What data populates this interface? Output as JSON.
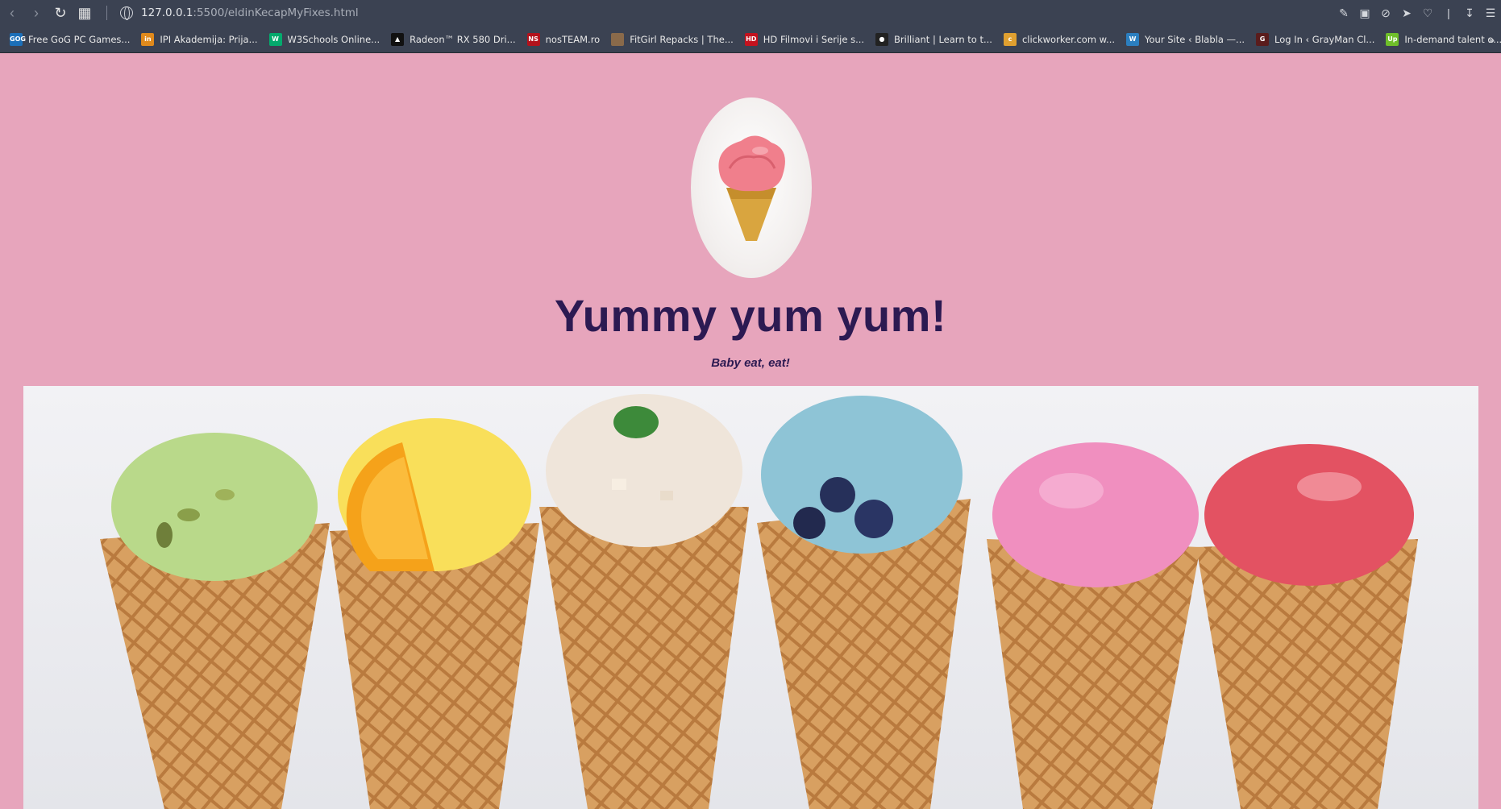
{
  "browser": {
    "url_host": "127.0.0.1",
    "url_path": ":5500/eldinKecapMyFixes.html",
    "bookmarks": [
      {
        "label": "Free GoG PC Games...",
        "color": "#1c6fb8",
        "icon_text": "GOG"
      },
      {
        "label": "IPI Akademija: Prija...",
        "color": "#e08a1c",
        "icon_text": "in"
      },
      {
        "label": "W3Schools Online...",
        "color": "#04aa6d",
        "icon_text": "W"
      },
      {
        "label": "Radeon™ RX 580 Dri...",
        "color": "#111111",
        "icon_text": "▲"
      },
      {
        "label": "nosTEAM.ro",
        "color": "#b3121c",
        "icon_text": "NS"
      },
      {
        "label": "FitGirl Repacks | The...",
        "color": "#8a6a4a",
        "icon_text": ""
      },
      {
        "label": "HD Filmovi i Serije s...",
        "color": "#c4121e",
        "icon_text": "HD"
      },
      {
        "label": "Brilliant | Learn to t...",
        "color": "#222222",
        "icon_text": "●"
      },
      {
        "label": "clickworker.com w...",
        "color": "#e0a030",
        "icon_text": "c"
      },
      {
        "label": "Your Site ‹ Blabla —...",
        "color": "#2b7fc0",
        "icon_text": "W"
      },
      {
        "label": "Log In ‹ GrayMan Cl...",
        "color": "#5a1c1c",
        "icon_text": "G"
      },
      {
        "label": "In-demand talent o...",
        "color": "#6fbf2a",
        "icon_text": "Up"
      }
    ]
  },
  "page": {
    "title": "Yummy yum yum!",
    "subtitle": "Baby eat, eat!"
  },
  "colors": {
    "background": "#e7a5bc",
    "heading": "#2c1a52"
  }
}
